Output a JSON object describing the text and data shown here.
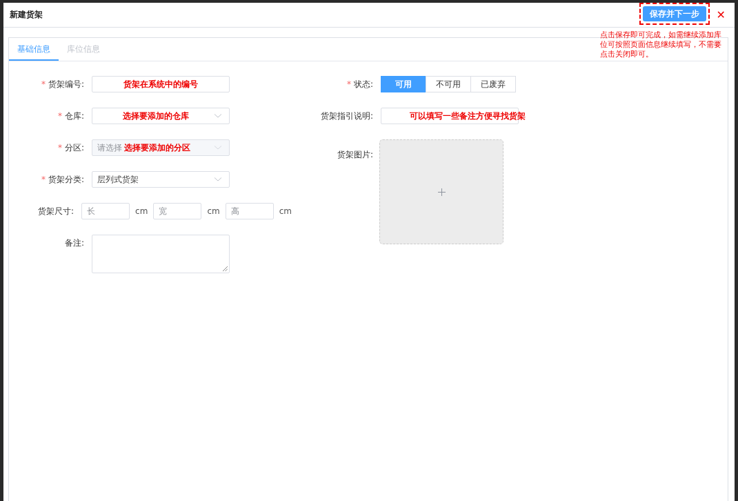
{
  "dialog": {
    "title": "新建货架",
    "primary_button": "保存并下一步",
    "close_icon": "✕",
    "note": "点击保存即可完成，如需继续添加库位可按照页面信息继续填写，不需要点击关闭即可。"
  },
  "tabs": [
    {
      "label": "基础信息",
      "selected": true
    },
    {
      "label": "库位信息",
      "selected": false
    }
  ],
  "left_fields": [
    {
      "label": "货架编号:",
      "required_mark": "*",
      "kind": "text",
      "annotation": "货架在系统中的编号"
    },
    {
      "label": "仓库:",
      "required_mark": "*",
      "kind": "select",
      "disabled": false,
      "annotation": "选择要添加的仓库"
    },
    {
      "label": "分区:",
      "required_mark": "*",
      "kind": "select",
      "disabled": true,
      "placeholder": "请选择",
      "annotation": "选择要添加的分区"
    },
    {
      "label": "货架分类:",
      "required_mark": "*",
      "kind": "select",
      "disabled": false,
      "value": "层列式货架"
    },
    {
      "label": "货架尺寸:",
      "kind": "dims",
      "inputs": [
        {
          "placeholder": "长",
          "unit": "cm"
        },
        {
          "placeholder": "宽",
          "unit": "cm"
        },
        {
          "placeholder": "高",
          "unit": "cm"
        }
      ]
    },
    {
      "label": "备注:",
      "kind": "textarea"
    }
  ],
  "right_fields": [
    {
      "label": "状态:",
      "required_mark": "*",
      "kind": "segmented",
      "options": [
        {
          "label": "可用",
          "selected": true
        },
        {
          "label": "不可用",
          "selected": false
        },
        {
          "label": "已废弃",
          "selected": false
        }
      ]
    },
    {
      "label": "货架指引说明:",
      "kind": "text",
      "annotation": "可以填写一些备注方便寻找货架"
    },
    {
      "label": "货架图片:",
      "kind": "upload"
    }
  ]
}
